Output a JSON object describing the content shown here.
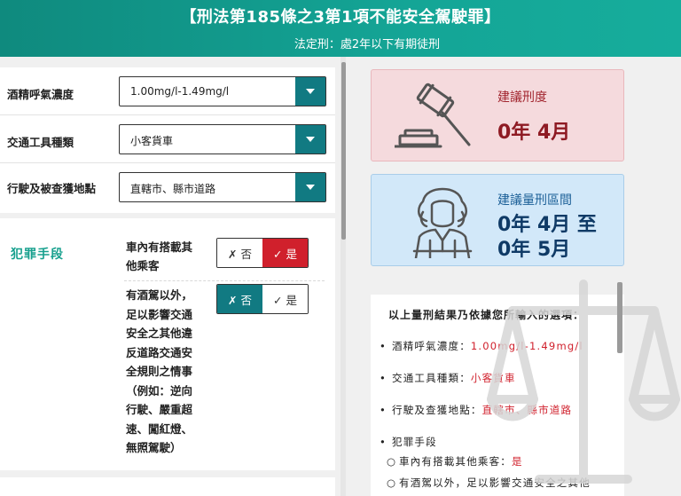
{
  "header": {
    "title": "【刑法第185條之3第1項不能安全駕駛罪】",
    "subtitle": "法定刑：處2年以下有期徒刑"
  },
  "form": {
    "fields": [
      {
        "label": "酒精呼氣濃度",
        "value": "1.00mg/l-1.49mg/l"
      },
      {
        "label": "交通工具種類",
        "value": "小客貨車"
      },
      {
        "label": "行駛及被查獲地點",
        "value": "直轄市、縣市道路"
      }
    ]
  },
  "crime": {
    "label": "犯罪手段",
    "q1_lines": [
      "車內有搭載其",
      "他乘客"
    ],
    "q2_lines": [
      "有酒駕以外，",
      "足以影響交通",
      "安全之其他違",
      "反道路交通安",
      "全規則之情事",
      "（例如：逆向",
      "行駛、嚴重超",
      "速、闖紅燈、",
      "無照駕駛）"
    ],
    "no_label": "✗ 否",
    "yes_label": "✓ 是",
    "q1_selected": "是",
    "q2_selected": "否"
  },
  "suggest": {
    "label": "建議刑度",
    "value": "0年 4月"
  },
  "range": {
    "label": "建議量刑區間",
    "line1": "0年 4月 至",
    "line2": "0年 5月"
  },
  "result": {
    "intro": "以上量刑結果乃依據您所輸入的選項：",
    "items": [
      {
        "key": "酒精呼氣濃度：",
        "value": "1.00mg/l-1.49mg/l"
      },
      {
        "key": "交通工具種類：",
        "value": "小客貨車"
      },
      {
        "key": "行駛及查獲地點：",
        "value": "直轄市、縣市道路"
      }
    ],
    "crime_header": "犯罪手段",
    "sub_items": [
      {
        "key": "車內有搭載其他乘客：",
        "value": "是"
      },
      {
        "key": "有酒駕以外，足以影響交通安全之其他",
        "value": ""
      }
    ]
  },
  "icons": {
    "gavel": "gavel-icon",
    "judge": "judge-icon",
    "scale": "scale-watermark-icon",
    "dropdown": "chevron-down-icon"
  },
  "colors": {
    "header": "#14a596",
    "select_arrow": "#117a82",
    "yes_active": "#d0202c",
    "no_active": "#117a82",
    "suggest_bg": "#f5dadd",
    "range_bg": "#d2e8f9"
  }
}
